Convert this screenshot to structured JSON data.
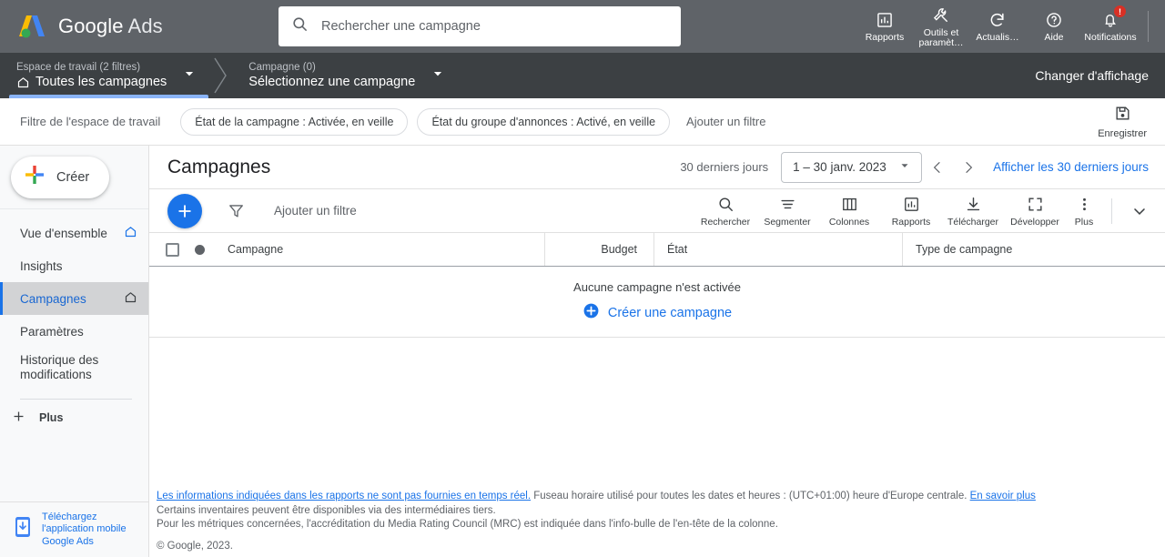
{
  "topbar": {
    "brand_google": "Google",
    "brand_ads": "Ads",
    "search_placeholder": "Rechercher une campagne",
    "actions": [
      {
        "label": "Rapports",
        "icon": "bar-chart-icon"
      },
      {
        "label": "Outils et paramèt…",
        "icon": "wrench-icon"
      },
      {
        "label": "Actualis…",
        "icon": "refresh-icon"
      },
      {
        "label": "Aide",
        "icon": "help-icon"
      },
      {
        "label": "Notifications",
        "icon": "bell-icon",
        "badge": "!"
      }
    ]
  },
  "workspace": {
    "tab1_sub": "Espace de travail (2 filtres)",
    "tab1_main": "Toutes les campagnes",
    "tab2_sub": "Campagne (0)",
    "tab2_main": "Sélectionnez une campagne",
    "change_view": "Changer d'affichage"
  },
  "filters": {
    "label": "Filtre de l'espace de travail",
    "chips": [
      "État de la campagne : Activée, en veille",
      "État du groupe d'annonces : Activé, en veille"
    ],
    "add": "Ajouter un filtre",
    "save": "Enregistrer"
  },
  "sidebar": {
    "create": "Créer",
    "items": [
      {
        "label": "Vue d'ensemble",
        "home": true,
        "active": false
      },
      {
        "label": "Insights",
        "home": false,
        "active": false
      },
      {
        "label": "Campagnes",
        "home": true,
        "active": true
      },
      {
        "label": "Paramètres",
        "home": false,
        "active": false
      },
      {
        "label": "Historique des modifications",
        "home": false,
        "active": false
      }
    ],
    "more": "Plus",
    "mobile_promo": "Téléchargez l'application mobile Google Ads"
  },
  "page": {
    "title": "Campagnes",
    "date_preset": "30 derniers jours",
    "date_range": "1 – 30 janv. 2023",
    "show_last_30": "Afficher les 30 derniers jours"
  },
  "toolbar": {
    "add_filter": "Ajouter un filtre",
    "tools": [
      {
        "label": "Rechercher",
        "icon": "search-icon"
      },
      {
        "label": "Segmenter",
        "icon": "segment-icon"
      },
      {
        "label": "Colonnes",
        "icon": "columns-icon"
      },
      {
        "label": "Rapports",
        "icon": "bar-chart-icon"
      },
      {
        "label": "Télécharger",
        "icon": "download-icon"
      },
      {
        "label": "Développer",
        "icon": "expand-icon"
      },
      {
        "label": "Plus",
        "icon": "more-vert-icon"
      }
    ]
  },
  "table": {
    "columns": [
      "Campagne",
      "Budget",
      "État",
      "Type de campagne"
    ],
    "rows": [],
    "empty_message": "Aucune campagne n'est activée",
    "empty_cta": "Créer une campagne"
  },
  "footer": {
    "link1": "Les informations indiquées dans les rapports ne sont pas fournies en temps réel.",
    "line1_rest": " Fuseau horaire utilisé pour toutes les dates et heures : (UTC+01:00) heure d'Europe centrale. ",
    "link2": "En savoir plus",
    "line2": "Certains inventaires peuvent être disponibles via des intermédiaires tiers.",
    "line3": "Pour les métriques concernées, l'accréditation du Media Rating Council (MRC) est indiquée dans l'info-bulle de l'en-tête de la colonne.",
    "copyright": "© Google, 2023."
  },
  "colors": {
    "brand_blue": "#1a73e8",
    "topbar_grey": "#5f6368",
    "wsbar_grey": "#3c4043",
    "accent_underline": "#8ab4f8"
  }
}
